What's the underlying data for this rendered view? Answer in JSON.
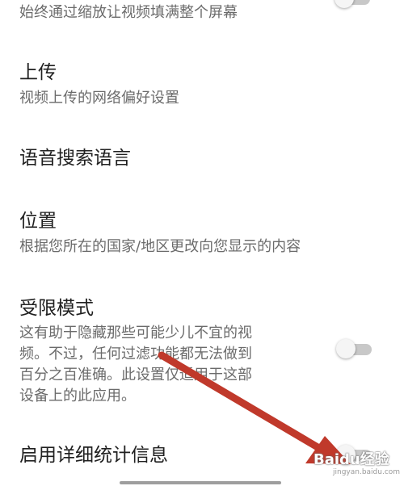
{
  "settings": {
    "item0": {
      "desc": "始终通过缩放让视频填满整个屏幕"
    },
    "upload": {
      "title": "上传",
      "desc": "视频上传的网络偏好设置"
    },
    "voice_search": {
      "title": "语音搜索语言"
    },
    "location": {
      "title": "位置",
      "desc": "根据您所在的国家/地区更改向您显示的内容"
    },
    "restricted": {
      "title": "受限模式",
      "desc_line1": "这有助于隐藏那些可能少儿不宜的视",
      "desc_line2": "频。不过，任何过滤功能都无法做到",
      "desc_line3": "百分之百准确。此设置仅适用于这部",
      "desc_line4": "设备上的此应用。"
    },
    "stats": {
      "title": "启用详细统计信息"
    }
  },
  "toggles": {
    "fill_screen": false,
    "restricted_mode": false,
    "detailed_stats": false
  },
  "colors": {
    "arrow": "#c0392b",
    "toggle_track": "#c8c8c8",
    "toggle_knob": "#f5f5f5"
  },
  "watermark": {
    "text": "Baidu经验",
    "sub": "jingyan.baidu.com"
  }
}
